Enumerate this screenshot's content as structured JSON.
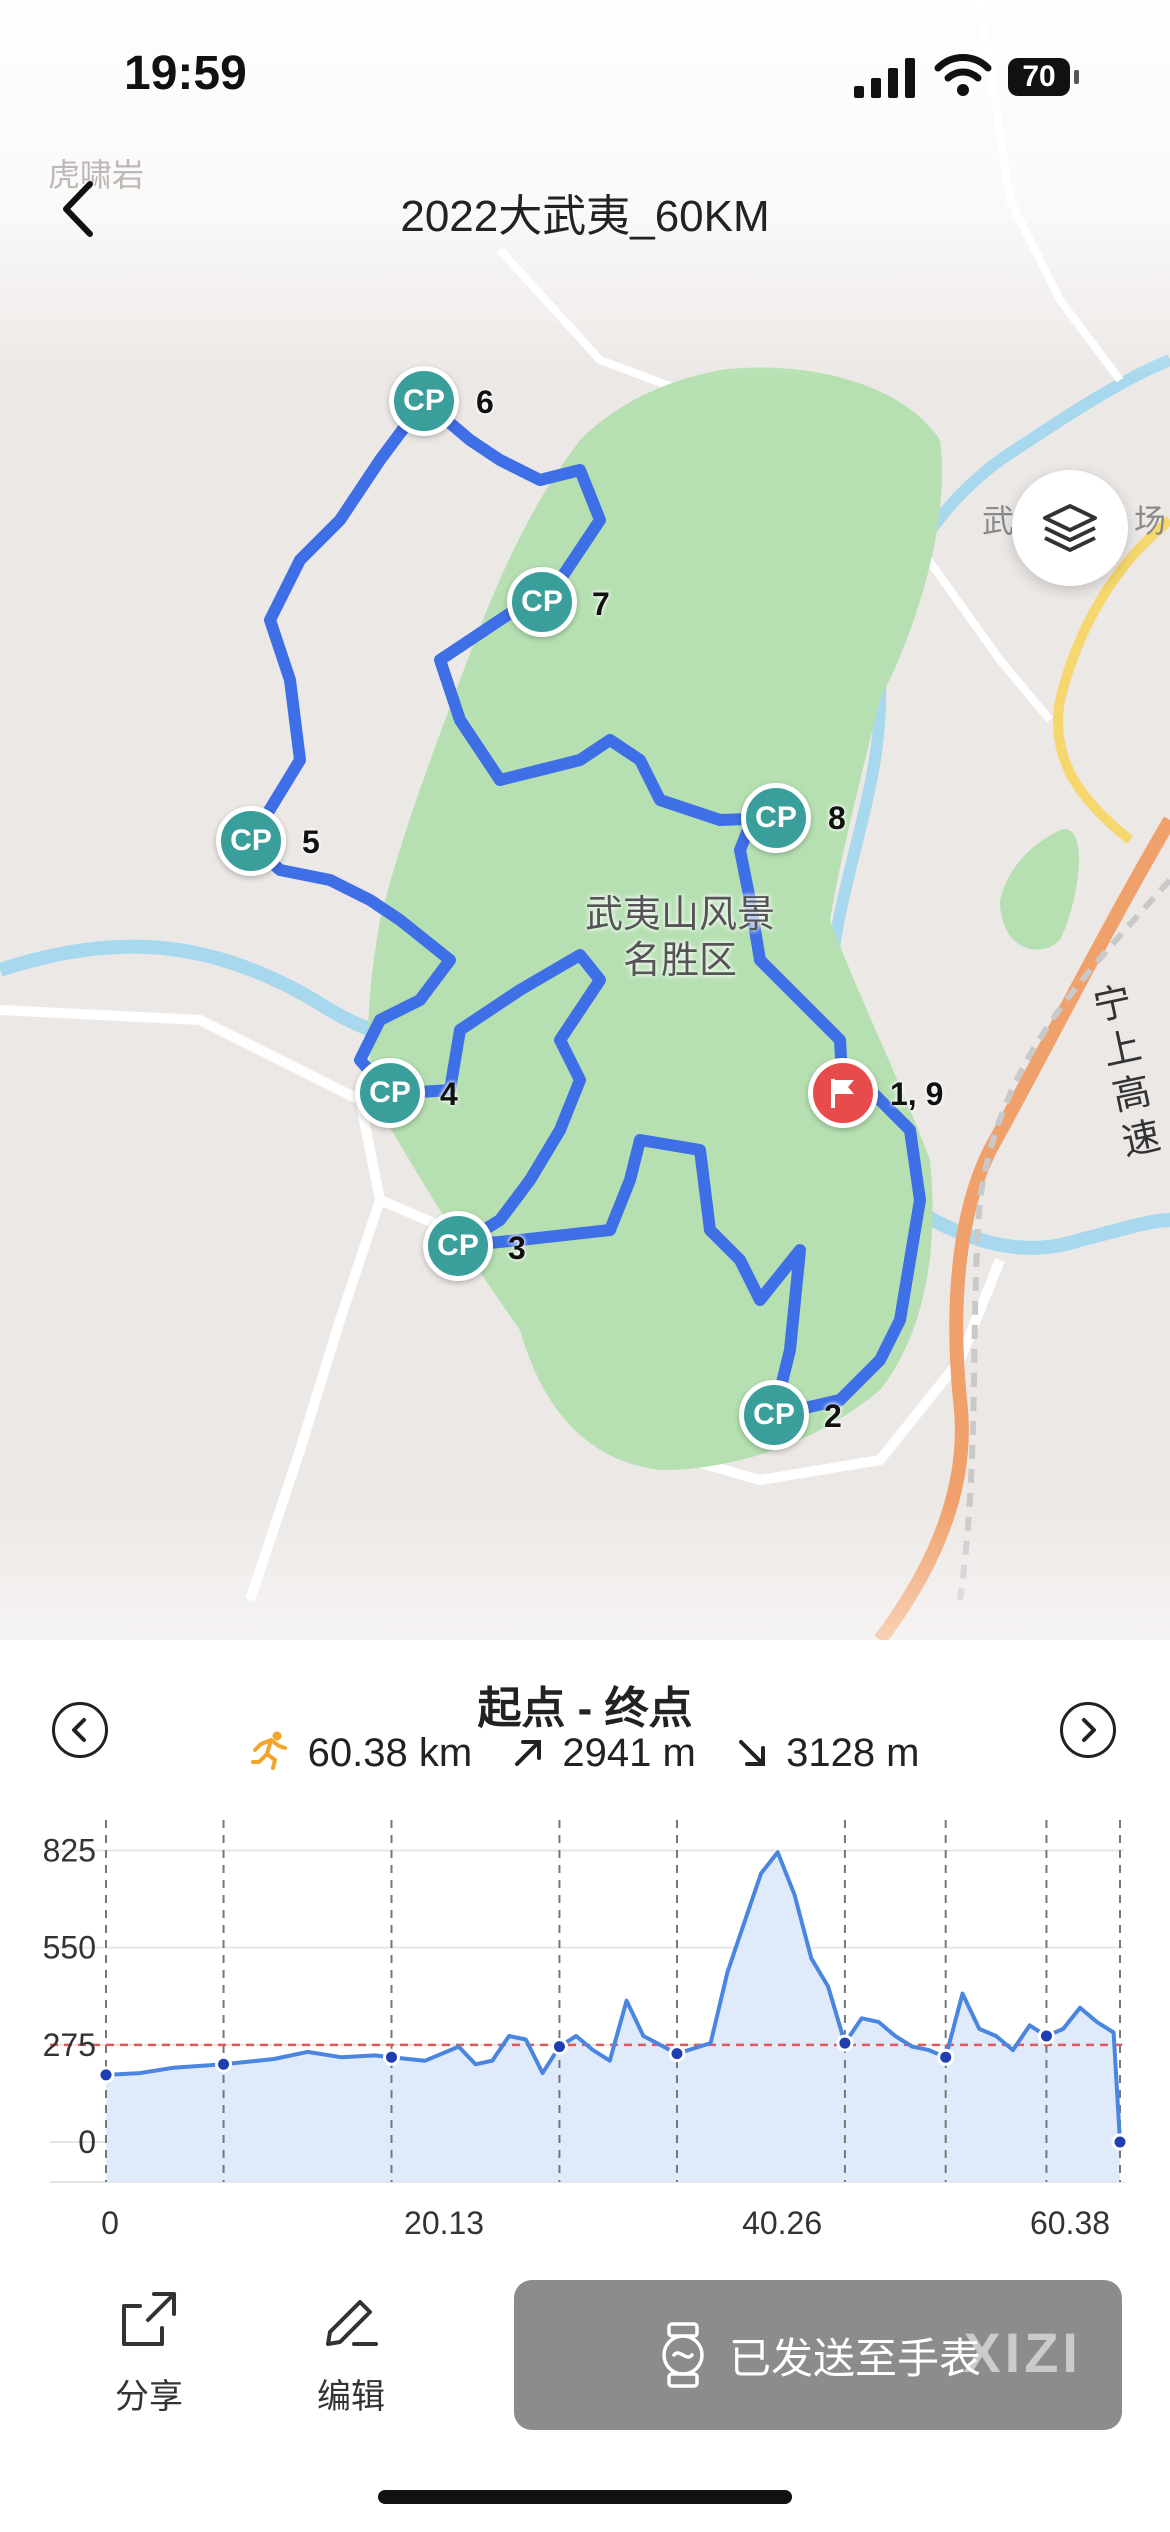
{
  "status_bar": {
    "time": "19:59",
    "battery": "70"
  },
  "header": {
    "title": "2022大武夷_60KM"
  },
  "map": {
    "labels": {
      "top_left": "虎啸岩",
      "right_partial": "武",
      "right_partial2": "场",
      "park": "武夷山风景名胜区",
      "highway": "宁上高速"
    },
    "checkpoints": [
      {
        "label": "CP",
        "num": "2"
      },
      {
        "label": "CP",
        "num": "3"
      },
      {
        "label": "CP",
        "num": "4"
      },
      {
        "label": "CP",
        "num": "5"
      },
      {
        "label": "CP",
        "num": "6"
      },
      {
        "label": "CP",
        "num": "7"
      },
      {
        "label": "CP",
        "num": "8"
      }
    ],
    "start_finish": "1, 9",
    "route_color": "#3f6fe6",
    "park_color": "#b6e0b2"
  },
  "segment": {
    "title": "起点 - 终点",
    "distance": "60.38 km",
    "ascent": "2941 m",
    "descent": "3128 m"
  },
  "chart_data": {
    "type": "area",
    "x_ticks": [
      "0",
      "20.13",
      "40.26",
      "60.38"
    ],
    "y_ticks": [
      "825",
      "550",
      "275",
      "0"
    ],
    "reference_line_y": 275,
    "x": [
      0,
      2,
      4,
      7,
      10,
      12,
      14,
      16,
      17,
      19,
      21,
      22,
      23,
      24,
      25,
      26,
      27,
      28,
      29,
      30,
      31,
      32,
      34,
      36,
      37,
      38,
      39,
      40,
      41,
      42,
      43,
      44,
      45,
      46,
      47,
      48,
      49,
      50,
      51,
      52,
      53,
      54,
      55,
      56,
      57,
      58,
      59,
      60,
      60.38
    ],
    "y": [
      190,
      195,
      210,
      220,
      235,
      255,
      240,
      245,
      240,
      230,
      270,
      220,
      230,
      300,
      290,
      195,
      270,
      300,
      260,
      230,
      400,
      300,
      250,
      280,
      480,
      620,
      760,
      820,
      700,
      520,
      440,
      280,
      350,
      340,
      300,
      270,
      260,
      240,
      420,
      320,
      300,
      260,
      330,
      300,
      320,
      380,
      340,
      310,
      0
    ],
    "checkpoint_x": [
      0,
      7,
      17,
      27,
      34,
      44,
      50,
      56,
      60.38
    ],
    "ylim": [
      0,
      900
    ],
    "xlim": [
      0,
      60.38
    ],
    "line_color": "#4a86e0",
    "fill_color": "#dce9fa",
    "reference_color": "#e05a5a"
  },
  "actions": {
    "share": "分享",
    "edit": "编辑",
    "send": "已发送至手表",
    "watermark": "XIZI"
  }
}
